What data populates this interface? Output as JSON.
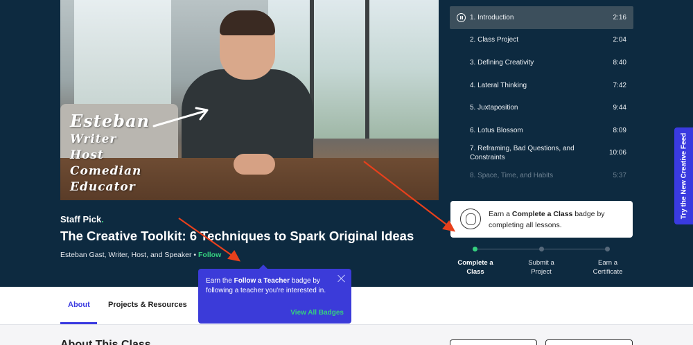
{
  "video": {
    "overlay_lines": [
      "Esteban",
      "Writer",
      "Host",
      "Comedian",
      "Educator"
    ]
  },
  "class_info": {
    "staff_pick": "Staff Pick",
    "staff_pick_dot": ".",
    "title": "The Creative Toolkit: 6 Techniques to Spark Original Ideas",
    "byline": "Esteban Gast, Writer, Host, and Speaker",
    "byline_sep": " • ",
    "follow_label": "Follow"
  },
  "lessons": [
    {
      "title": "1. Introduction",
      "duration": "2:16"
    },
    {
      "title": "2. Class Project",
      "duration": "2:04"
    },
    {
      "title": "3. Defining Creativity",
      "duration": "8:40"
    },
    {
      "title": "4. Lateral Thinking",
      "duration": "7:42"
    },
    {
      "title": "5. Juxtaposition",
      "duration": "9:44"
    },
    {
      "title": "6. Lotus Blossom",
      "duration": "8:09"
    },
    {
      "title": "7. Reframing, Bad Questions, and Constraints",
      "duration": "10:06"
    },
    {
      "title": "8. Space, Time, and Habits",
      "duration": "5:37"
    }
  ],
  "badge_card": {
    "prefix": "Earn a ",
    "bold": "Complete a Class",
    "suffix": " badge by completing all lessons."
  },
  "progress_steps": [
    {
      "line1": "Complete a",
      "line2": "Class"
    },
    {
      "line1": "Submit a",
      "line2": "Project"
    },
    {
      "line1": "Earn a",
      "line2": "Certificate"
    }
  ],
  "side_tab": "Try the New Creative Feed",
  "tabs": [
    {
      "label": "About"
    },
    {
      "label": "Projects & Resources"
    }
  ],
  "about_heading": "About This Class",
  "tooltip": {
    "prefix": "Earn the ",
    "bold": "Follow a Teacher",
    "suffix": " badge by following a teacher you're interested in.",
    "link": "View All Badges"
  },
  "colors": {
    "hero_bg": "#0d2a40",
    "accent_green": "#35d07f",
    "accent_blue": "#3a3ae0",
    "annotation_red": "#e8401c"
  }
}
